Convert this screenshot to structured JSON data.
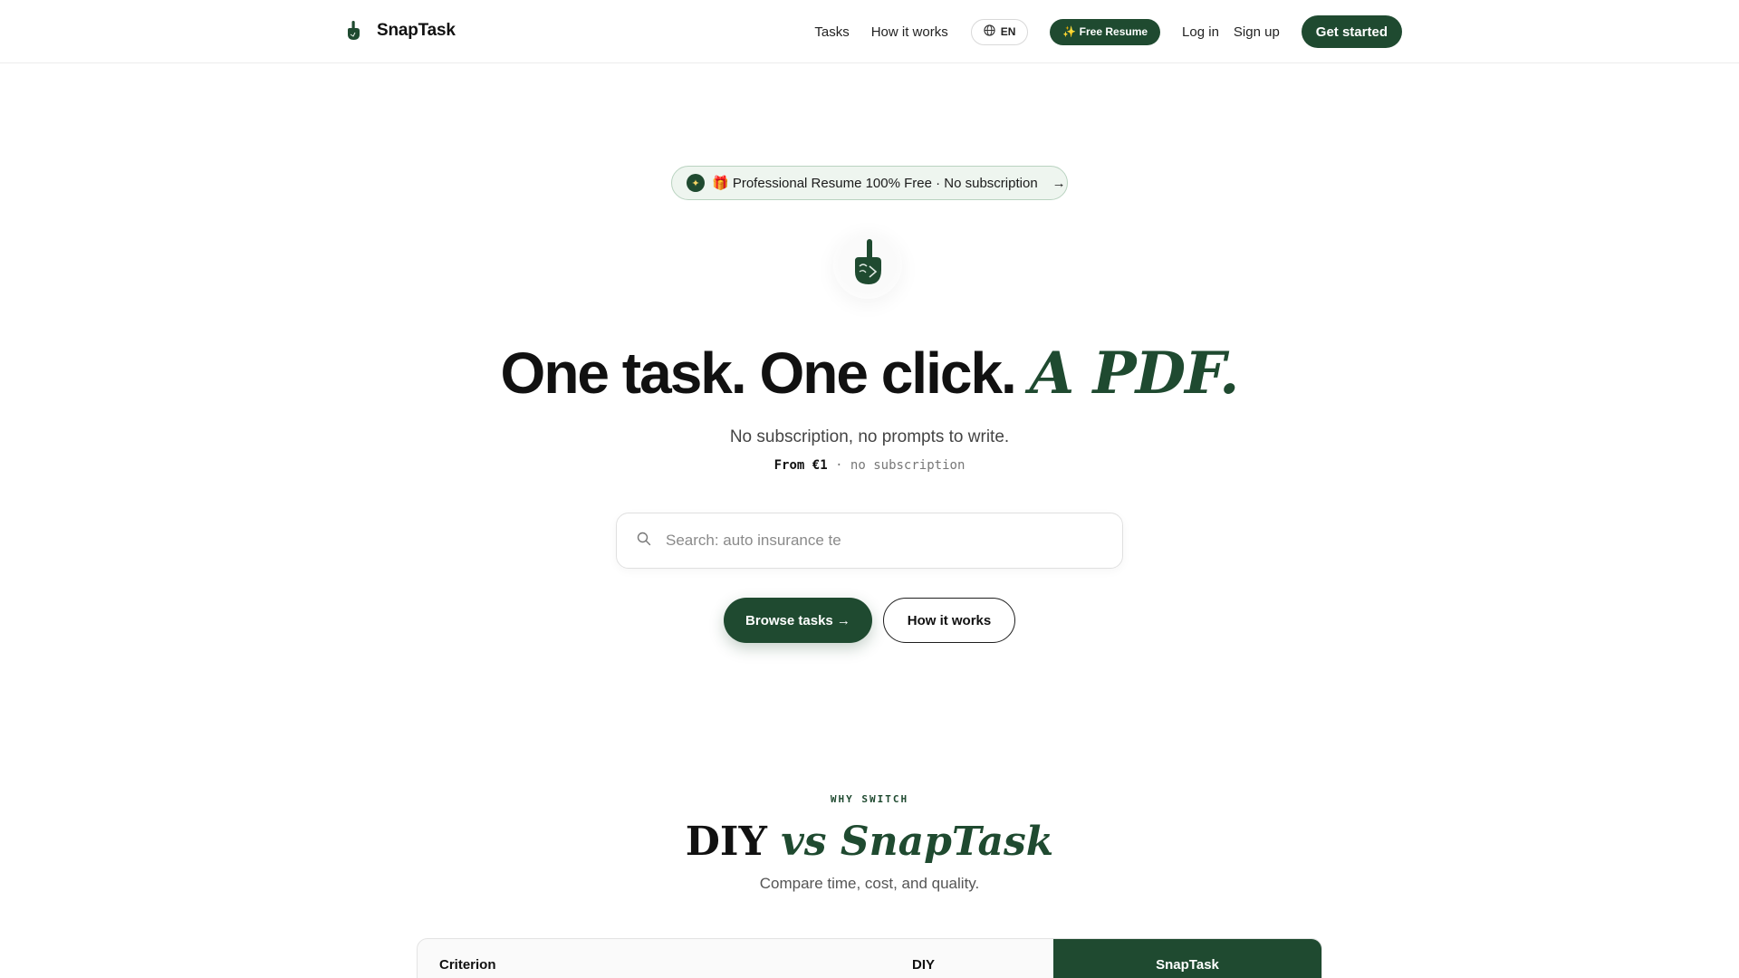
{
  "nav": {
    "brand": "SnapTask",
    "links": {
      "tasks": "Tasks",
      "how_it_works": "How it works"
    },
    "language": "EN",
    "free_resume": "✨ Free Resume",
    "login": "Log in",
    "signup": "Sign up",
    "get_started": "Get started"
  },
  "hero": {
    "promo": "🎁 Professional Resume 100% Free · No subscription",
    "promo_arrow": "→",
    "headline_main": "One task. One click.",
    "headline_accent": "A PDF.",
    "subtitle": "No subscription, no prompts to write.",
    "price_from": "From €1",
    "price_rest": "· no subscription",
    "search_placeholder": "Search: auto insurance te",
    "browse_button": "Browse tasks →",
    "how_button": "How it works"
  },
  "why": {
    "eyebrow": "WHY SWITCH",
    "title_main": "DIY",
    "title_accent": "vs SnapTask",
    "subtitle": "Compare time, cost, and quality.",
    "table_headers": {
      "criterion": "Criterion",
      "diy": "DIY",
      "snaptask": "SnapTask"
    }
  },
  "colors": {
    "brand_green": "#1f4a30",
    "pill_bg": "#eef5ef"
  },
  "icons": {
    "brand": "pointing-hand-icon",
    "language": "globe-icon",
    "search": "search-icon",
    "promo": "sparkle-icon"
  }
}
